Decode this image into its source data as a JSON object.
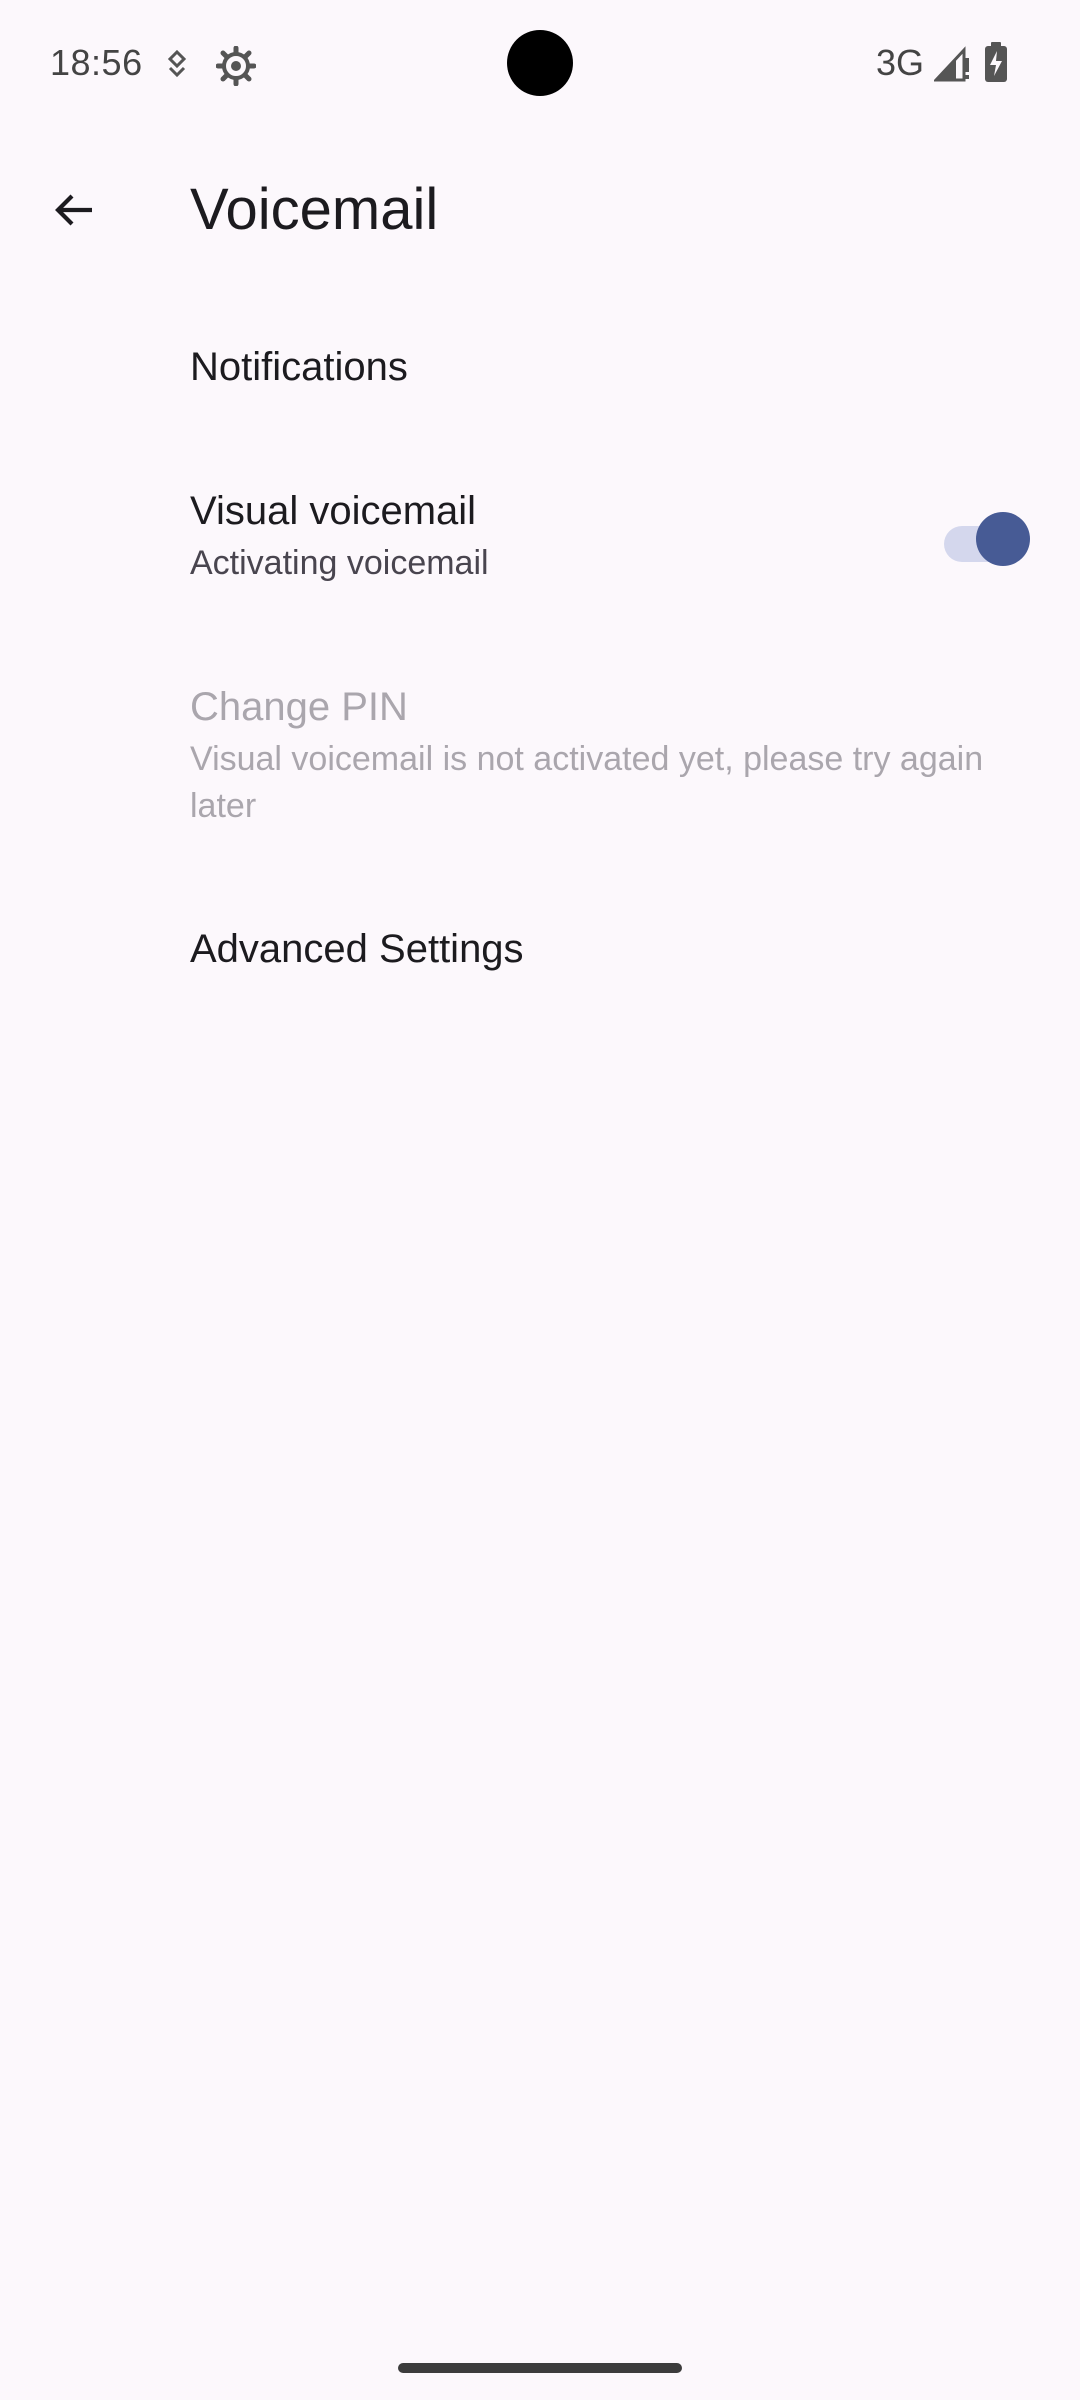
{
  "status_bar": {
    "time": "18:56",
    "network": "3G",
    "icons": [
      "download-notification-icon",
      "settings-notification-icon",
      "signal-icon",
      "battery-charging-icon"
    ]
  },
  "header": {
    "title": "Voicemail",
    "back_icon": "arrow-back-icon"
  },
  "preferences": {
    "notifications": {
      "title": "Notifications"
    },
    "visual_voicemail": {
      "title": "Visual voicemail",
      "summary": "Activating voicemail",
      "enabled": true
    },
    "change_pin": {
      "title": "Change PIN",
      "summary": "Visual voicemail is not activated yet, please try again later",
      "disabled": true
    },
    "advanced": {
      "title": "Advanced Settings"
    }
  },
  "colors": {
    "background": "#fcf8fc",
    "switch_thumb": "#475b95",
    "switch_track": "#d4d7ed",
    "disabled_text": "#aaa6ad"
  }
}
